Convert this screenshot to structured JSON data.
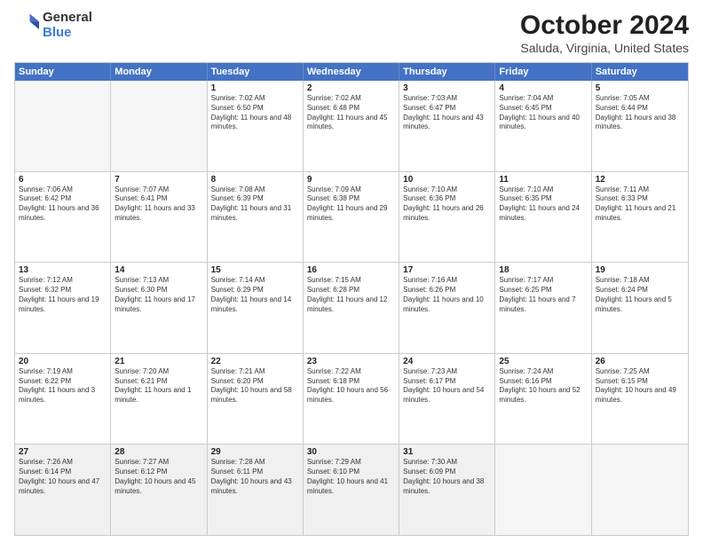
{
  "logo": {
    "general": "General",
    "blue": "Blue"
  },
  "title": {
    "month": "October 2024",
    "location": "Saluda, Virginia, United States"
  },
  "header_days": [
    "Sunday",
    "Monday",
    "Tuesday",
    "Wednesday",
    "Thursday",
    "Friday",
    "Saturday"
  ],
  "weeks": [
    [
      {
        "day": "",
        "empty": true
      },
      {
        "day": "",
        "empty": true
      },
      {
        "day": "1",
        "sunrise": "Sunrise: 7:02 AM",
        "sunset": "Sunset: 6:50 PM",
        "daylight": "Daylight: 11 hours and 48 minutes."
      },
      {
        "day": "2",
        "sunrise": "Sunrise: 7:02 AM",
        "sunset": "Sunset: 6:48 PM",
        "daylight": "Daylight: 11 hours and 45 minutes."
      },
      {
        "day": "3",
        "sunrise": "Sunrise: 7:03 AM",
        "sunset": "Sunset: 6:47 PM",
        "daylight": "Daylight: 11 hours and 43 minutes."
      },
      {
        "day": "4",
        "sunrise": "Sunrise: 7:04 AM",
        "sunset": "Sunset: 6:45 PM",
        "daylight": "Daylight: 11 hours and 40 minutes."
      },
      {
        "day": "5",
        "sunrise": "Sunrise: 7:05 AM",
        "sunset": "Sunset: 6:44 PM",
        "daylight": "Daylight: 11 hours and 38 minutes."
      }
    ],
    [
      {
        "day": "6",
        "sunrise": "Sunrise: 7:06 AM",
        "sunset": "Sunset: 6:42 PM",
        "daylight": "Daylight: 11 hours and 36 minutes."
      },
      {
        "day": "7",
        "sunrise": "Sunrise: 7:07 AM",
        "sunset": "Sunset: 6:41 PM",
        "daylight": "Daylight: 11 hours and 33 minutes."
      },
      {
        "day": "8",
        "sunrise": "Sunrise: 7:08 AM",
        "sunset": "Sunset: 6:39 PM",
        "daylight": "Daylight: 11 hours and 31 minutes."
      },
      {
        "day": "9",
        "sunrise": "Sunrise: 7:09 AM",
        "sunset": "Sunset: 6:38 PM",
        "daylight": "Daylight: 11 hours and 29 minutes."
      },
      {
        "day": "10",
        "sunrise": "Sunrise: 7:10 AM",
        "sunset": "Sunset: 6:36 PM",
        "daylight": "Daylight: 11 hours and 26 minutes."
      },
      {
        "day": "11",
        "sunrise": "Sunrise: 7:10 AM",
        "sunset": "Sunset: 6:35 PM",
        "daylight": "Daylight: 11 hours and 24 minutes."
      },
      {
        "day": "12",
        "sunrise": "Sunrise: 7:11 AM",
        "sunset": "Sunset: 6:33 PM",
        "daylight": "Daylight: 11 hours and 21 minutes."
      }
    ],
    [
      {
        "day": "13",
        "sunrise": "Sunrise: 7:12 AM",
        "sunset": "Sunset: 6:32 PM",
        "daylight": "Daylight: 11 hours and 19 minutes."
      },
      {
        "day": "14",
        "sunrise": "Sunrise: 7:13 AM",
        "sunset": "Sunset: 6:30 PM",
        "daylight": "Daylight: 11 hours and 17 minutes."
      },
      {
        "day": "15",
        "sunrise": "Sunrise: 7:14 AM",
        "sunset": "Sunset: 6:29 PM",
        "daylight": "Daylight: 11 hours and 14 minutes."
      },
      {
        "day": "16",
        "sunrise": "Sunrise: 7:15 AM",
        "sunset": "Sunset: 6:28 PM",
        "daylight": "Daylight: 11 hours and 12 minutes."
      },
      {
        "day": "17",
        "sunrise": "Sunrise: 7:16 AM",
        "sunset": "Sunset: 6:26 PM",
        "daylight": "Daylight: 11 hours and 10 minutes."
      },
      {
        "day": "18",
        "sunrise": "Sunrise: 7:17 AM",
        "sunset": "Sunset: 6:25 PM",
        "daylight": "Daylight: 11 hours and 7 minutes."
      },
      {
        "day": "19",
        "sunrise": "Sunrise: 7:18 AM",
        "sunset": "Sunset: 6:24 PM",
        "daylight": "Daylight: 11 hours and 5 minutes."
      }
    ],
    [
      {
        "day": "20",
        "sunrise": "Sunrise: 7:19 AM",
        "sunset": "Sunset: 6:22 PM",
        "daylight": "Daylight: 11 hours and 3 minutes."
      },
      {
        "day": "21",
        "sunrise": "Sunrise: 7:20 AM",
        "sunset": "Sunset: 6:21 PM",
        "daylight": "Daylight: 11 hours and 1 minute."
      },
      {
        "day": "22",
        "sunrise": "Sunrise: 7:21 AM",
        "sunset": "Sunset: 6:20 PM",
        "daylight": "Daylight: 10 hours and 58 minutes."
      },
      {
        "day": "23",
        "sunrise": "Sunrise: 7:22 AM",
        "sunset": "Sunset: 6:18 PM",
        "daylight": "Daylight: 10 hours and 56 minutes."
      },
      {
        "day": "24",
        "sunrise": "Sunrise: 7:23 AM",
        "sunset": "Sunset: 6:17 PM",
        "daylight": "Daylight: 10 hours and 54 minutes."
      },
      {
        "day": "25",
        "sunrise": "Sunrise: 7:24 AM",
        "sunset": "Sunset: 6:16 PM",
        "daylight": "Daylight: 10 hours and 52 minutes."
      },
      {
        "day": "26",
        "sunrise": "Sunrise: 7:25 AM",
        "sunset": "Sunset: 6:15 PM",
        "daylight": "Daylight: 10 hours and 49 minutes."
      }
    ],
    [
      {
        "day": "27",
        "sunrise": "Sunrise: 7:26 AM",
        "sunset": "Sunset: 6:14 PM",
        "daylight": "Daylight: 10 hours and 47 minutes."
      },
      {
        "day": "28",
        "sunrise": "Sunrise: 7:27 AM",
        "sunset": "Sunset: 6:12 PM",
        "daylight": "Daylight: 10 hours and 45 minutes."
      },
      {
        "day": "29",
        "sunrise": "Sunrise: 7:28 AM",
        "sunset": "Sunset: 6:11 PM",
        "daylight": "Daylight: 10 hours and 43 minutes."
      },
      {
        "day": "30",
        "sunrise": "Sunrise: 7:29 AM",
        "sunset": "Sunset: 6:10 PM",
        "daylight": "Daylight: 10 hours and 41 minutes."
      },
      {
        "day": "31",
        "sunrise": "Sunrise: 7:30 AM",
        "sunset": "Sunset: 6:09 PM",
        "daylight": "Daylight: 10 hours and 38 minutes."
      },
      {
        "day": "",
        "empty": true
      },
      {
        "day": "",
        "empty": true
      }
    ]
  ]
}
